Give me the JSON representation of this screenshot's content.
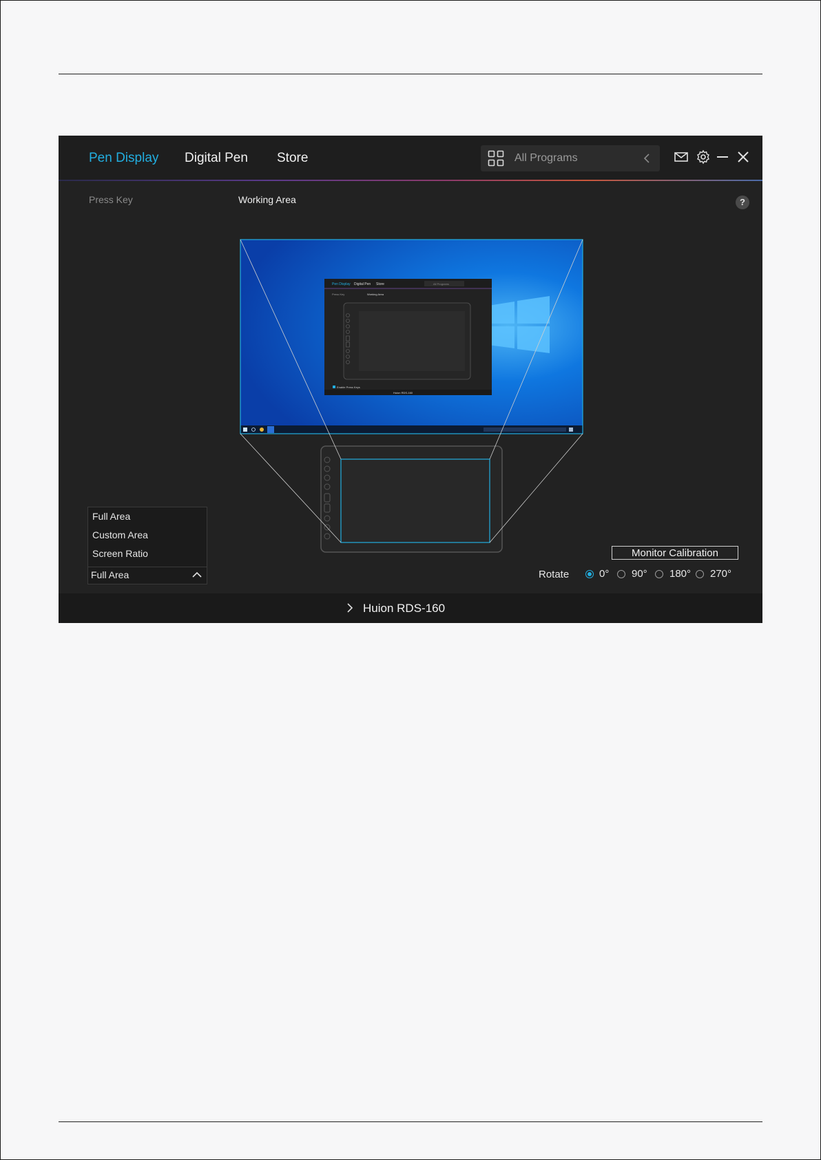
{
  "nav": {
    "tabs": [
      {
        "label": "Pen Display",
        "active": true
      },
      {
        "label": "Digital Pen",
        "active": false
      },
      {
        "label": "Store",
        "active": false
      }
    ],
    "program_selector": "All Programs"
  },
  "subtabs": {
    "press_key": "Press Key",
    "working_area": "Working Area"
  },
  "help_label": "?",
  "area_dropdown": {
    "options": [
      "Full Area",
      "Custom Area",
      "Screen Ratio"
    ],
    "selected": "Full Area"
  },
  "monitor_calibration": "Monitor Calibration",
  "rotate": {
    "label": "Rotate",
    "options": [
      "0°",
      "90°",
      "180°",
      "270°"
    ],
    "selected": "0°"
  },
  "device_name": "Huion RDS-160",
  "preview": {
    "mini_tabs": [
      "Pen Display",
      "Digital Pen",
      "Store"
    ],
    "mini_search": "All Programs",
    "mini_subtabs": [
      "Press Key",
      "Working Area"
    ],
    "mini_checkbox": "Enable Press Keys",
    "mini_device": "Huion RDS-160"
  },
  "colors": {
    "accent": "#22aee0",
    "app_bg": "#222222",
    "desktop_blue": "#0a5fd6"
  }
}
